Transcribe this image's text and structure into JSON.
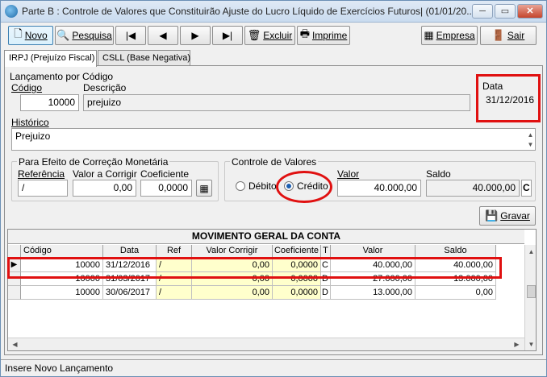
{
  "window": {
    "title": "Parte B : Controle de Valores que Constituirão Ajuste do Lucro Líquido de Exercícios Futuros| (01/01/20...",
    "minimize": "─",
    "restore": "▭",
    "close": "✕"
  },
  "toolbar": {
    "novo": "Novo",
    "pesquisa": "Pesquisa",
    "first": "|◀",
    "prev": "◀",
    "next": "▶",
    "last": "▶|",
    "excluir": "Excluir",
    "imprime": "Imprime",
    "empresa": "Empresa",
    "sair": "Sair"
  },
  "tabs": [
    "IRPJ (Prejuízo Fiscal)",
    "CSLL (Base Negativa)"
  ],
  "form": {
    "lancamento_group": "Lançamento por Código",
    "codigo_label": "Código",
    "codigo_value": "10000",
    "descricao_label": "Descrição",
    "descricao_value": "prejuizo",
    "data_label": "Data",
    "data_value": "31/12/2016",
    "historico_label": "Histórico",
    "historico_value": "Prejuizo",
    "correcao_group": "Para Efeito de Correção Monetária",
    "referencia_label": "Referência",
    "referencia_value": "/",
    "valor_corrigir_label": "Valor a Corrigir",
    "valor_corrigir_value": "0,00",
    "coeficiente_label": "Coeficiente",
    "coeficiente_value": "0,0000",
    "controle_group": "Controle de Valores",
    "debito_label": "Débito",
    "credito_label": "Crédito",
    "selected_type": "Crédito",
    "valor_label": "Valor",
    "valor_value": "40.000,00",
    "saldo_label": "Saldo",
    "saldo_value": "40.000,00",
    "saldo_flag": "C",
    "gravar": "Gravar"
  },
  "grid": {
    "title": "MOVIMENTO GERAL DA CONTA",
    "columns": [
      "Código",
      "Data",
      "Ref",
      "Valor Corrigir",
      "Coeficiente",
      "T",
      "Valor",
      "Saldo"
    ],
    "rows": [
      [
        "10000",
        "31/12/2016",
        "/",
        "0,00",
        "0,0000",
        "C",
        "40.000,00",
        "40.000,00"
      ],
      [
        "10000",
        "31/03/2017",
        "/",
        "0,00",
        "0,0000",
        "D",
        "27.000,00",
        "13.000,00"
      ],
      [
        "10000",
        "30/06/2017",
        "/",
        "0,00",
        "0,0000",
        "D",
        "13.000,00",
        "0,00"
      ]
    ],
    "current_row_marker": "▶"
  },
  "status": {
    "text": "Insere Novo Lançamento"
  },
  "colors": {
    "highlight_red": "#e01010",
    "yellow_cell": "#ffffcc"
  }
}
